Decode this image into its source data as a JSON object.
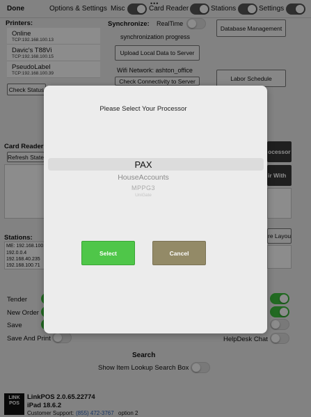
{
  "topbar": {
    "done": "Done",
    "options": "Options & Settings",
    "misc": "Misc",
    "card_reader": "Card Reader",
    "stations": "Stations",
    "settings": "Settings",
    "dots": "•••"
  },
  "printers": {
    "heading": "Printers:",
    "items": [
      {
        "name": "Online",
        "ip": "TCP:192.168.100.13"
      },
      {
        "name": "Davic's T88Vi",
        "ip": "TCP:192.168.100.15"
      },
      {
        "name": "PseudoLabel",
        "ip": "TCP:192.168.100.39"
      }
    ],
    "check_status": "Check Status"
  },
  "sync": {
    "heading": "Synchronize:",
    "realtime": "RealTime",
    "progress": "synchronization progress",
    "upload": "Upload Local Data to Server",
    "wifi": "Wifi Network: ashton_office",
    "check_conn": "Check Connectivity to Server"
  },
  "right_buttons": {
    "db_mgmt": "Database Management",
    "labor": "Labor Schedule",
    "processors": "ocessors",
    "pair_with": "ir With",
    "layout": "re Layout"
  },
  "card_reader": {
    "heading": "Card Reader:",
    "refresh": "Refresh State"
  },
  "stations": {
    "heading": "Stations:",
    "items": [
      "ME: 192.168.100",
      "192.0.0.4",
      "192.168.40.235",
      "192.168.100.71"
    ]
  },
  "toggles_left": [
    {
      "label": "Tender",
      "state": "on"
    },
    {
      "label": "New Order",
      "state": "on"
    },
    {
      "label": "Save",
      "state": "on"
    },
    {
      "label": "Save And Print",
      "state": "off"
    }
  ],
  "toggles_right": [
    {
      "label": "",
      "state": "on"
    },
    {
      "label": "",
      "state": "on"
    },
    {
      "label": "",
      "state": "off"
    },
    {
      "label": "HelpDesk Chat",
      "state": "off"
    }
  ],
  "search": {
    "heading": "Search",
    "show_lookup": "Show Item Lookup Search Box"
  },
  "footer": {
    "logo": "LINK POS",
    "version": "LinkPOS 2.0.65.22774",
    "ipad": "iPad 18.6.2",
    "support_label": "Customer Support:",
    "support_phone": "(855) 472-3767",
    "support_option": "option 2"
  },
  "dialog": {
    "title": "Please Select Your Processor",
    "options": [
      "PAX",
      "HouseAccounts",
      "MPPG3",
      "UniGate"
    ],
    "select": "Select",
    "cancel": "Cancel"
  },
  "colors": {
    "green": "#3ec13e",
    "cancel": "#938a67",
    "link": "#2a5db0"
  }
}
